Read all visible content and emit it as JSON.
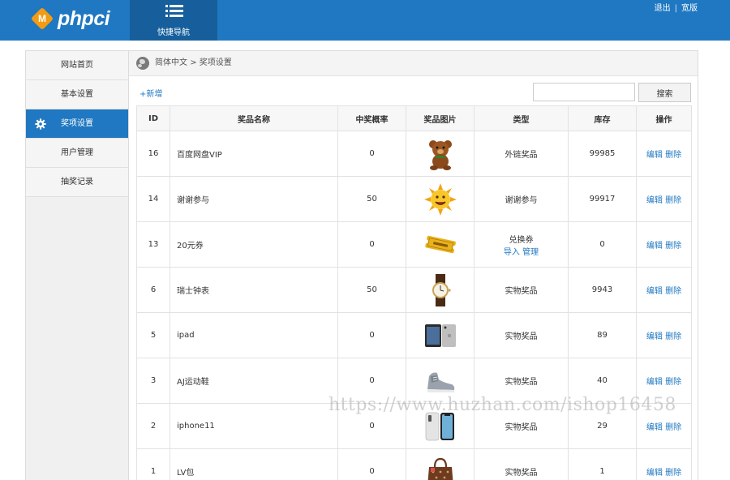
{
  "header": {
    "logo_text": "phpci",
    "logo_mark": "M",
    "quicknav_label": "快捷导航",
    "links": [
      "退出",
      "宽版"
    ],
    "bg_color": "#1f78c1"
  },
  "sidebar": {
    "items": [
      {
        "label": "网站首页"
      },
      {
        "label": "基本设置"
      },
      {
        "label": "奖项设置"
      },
      {
        "label": "用户管理"
      },
      {
        "label": "抽奖记录"
      }
    ],
    "active": "奖项设置"
  },
  "breadcrumb": {
    "root": "简体中文",
    "sep": ">",
    "current": "奖项设置"
  },
  "toolbar": {
    "add_label": "+新增",
    "search_value": "",
    "search_button": "搜索"
  },
  "table": {
    "headers": [
      "ID",
      "奖品名称",
      "中奖概率",
      "奖品图片",
      "类型",
      "库存",
      "操作"
    ],
    "rows": [
      {
        "id": "16",
        "name": "百度网盘VIP",
        "prob": "0",
        "image": "teddy-bear",
        "type": "外链奖品",
        "stock": "99985",
        "edit": "编辑",
        "del": "删除"
      },
      {
        "id": "14",
        "name": "谢谢参与",
        "prob": "50",
        "image": "sun-face",
        "type": "谢谢参与",
        "stock": "99917",
        "edit": "编辑",
        "del": "删除"
      },
      {
        "id": "13",
        "name": "20元券",
        "prob": "0",
        "image": "coupon-ticket",
        "type": "兑换券",
        "type_links": [
          "导入",
          "管理"
        ],
        "stock": "0",
        "edit": "编辑",
        "del": "删除"
      },
      {
        "id": "6",
        "name": "瑞士钟表",
        "prob": "50",
        "image": "wrist-watch",
        "type": "实物奖品",
        "stock": "9943",
        "edit": "编辑",
        "del": "删除"
      },
      {
        "id": "5",
        "name": "ipad",
        "prob": "0",
        "image": "ipad",
        "type": "实物奖品",
        "stock": "89",
        "edit": "编辑",
        "del": "删除"
      },
      {
        "id": "3",
        "name": "AJ运动鞋",
        "prob": "0",
        "image": "sneaker",
        "type": "实物奖品",
        "stock": "40",
        "edit": "编辑",
        "del": "删除"
      },
      {
        "id": "2",
        "name": "iphone11",
        "prob": "0",
        "image": "iphone",
        "type": "实物奖品",
        "stock": "29",
        "edit": "编辑",
        "del": "删除"
      },
      {
        "id": "1",
        "name": "LV包",
        "prob": "0",
        "image": "handbag",
        "type": "实物奖品",
        "stock": "1",
        "edit": "编辑",
        "del": "删除"
      }
    ]
  },
  "watermark": "https://www.huzhan.com/ishop16458"
}
